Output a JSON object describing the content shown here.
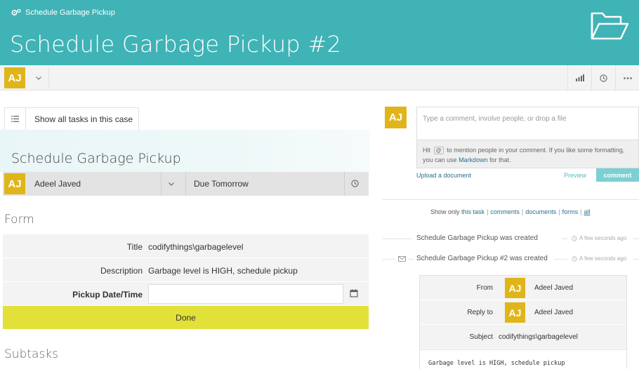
{
  "header": {
    "breadcrumb": "Schedule Garbage Pickup",
    "title": "Schedule Garbage Pickup #2",
    "bg_color": "#3fb3b6"
  },
  "subbar": {
    "avatar_initials": "AJ",
    "icons": [
      "gears-icon",
      "folder-icon",
      "chevron-down-icon",
      "bar-chart-icon",
      "clock-icon",
      "more-icon"
    ]
  },
  "task": {
    "show_all_label": "Show all tasks in this case",
    "title": "Schedule Garbage Pickup",
    "assignee_initials": "AJ",
    "assignee_name": "Adeel Javed",
    "due": "Due Tomorrow"
  },
  "form": {
    "heading": "Form",
    "rows": [
      {
        "label": "Title",
        "value": "codifythings\\garbagelevel"
      },
      {
        "label": "Description",
        "value": "Garbage level is HIGH, schedule pickup"
      },
      {
        "label": "Pickup Date/Time",
        "value": ""
      }
    ],
    "done_label": "Done",
    "done_color": "#e1e13a"
  },
  "subtasks": {
    "heading": "Subtasks"
  },
  "comment": {
    "avatar_initials": "AJ",
    "placeholder": "Type a comment, involve people, or drop a file",
    "hint_prefix": "Hit",
    "hint_at": "@",
    "hint_mid": "to mention people in your comment. If you like some formatting, you can use",
    "hint_markdown": "Markdown",
    "hint_suffix": "for that.",
    "upload_label": "Upload a document",
    "preview_label": "Preview",
    "comment_button": "comment"
  },
  "filter": {
    "prefix": "Show only",
    "options": [
      "this task",
      "comments",
      "documents",
      "forms",
      "all"
    ],
    "active": "all"
  },
  "events": [
    {
      "text": "Schedule Garbage Pickup was created",
      "time": "A few seconds ago"
    },
    {
      "text": "Schedule Garbage Pickup #2 was created",
      "time": "A few seconds ago"
    }
  ],
  "email": {
    "from_label": "From",
    "from_initials": "AJ",
    "from_name": "Adeel Javed",
    "reply_label": "Reply to",
    "reply_initials": "AJ",
    "reply_name": "Adeel Javed",
    "subject_label": "Subject",
    "subject_value": "codifythings\\garbagelevel",
    "body": "Garbage level is HIGH, schedule pickup"
  }
}
